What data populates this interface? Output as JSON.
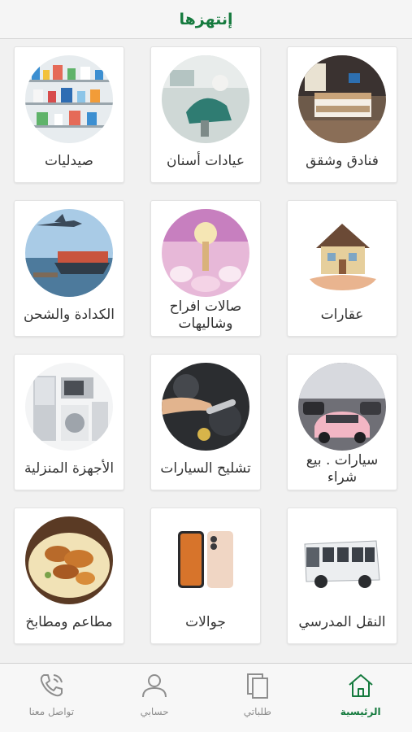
{
  "header": {
    "title": "إنتهزها"
  },
  "categories": [
    {
      "label": "فنادق وشقق",
      "icon": "hotel-room-photo"
    },
    {
      "label": "عيادات أسنان",
      "icon": "dental-clinic-photo"
    },
    {
      "label": "صيدليات",
      "icon": "pharmacy-photo"
    },
    {
      "label": "عقارات",
      "icon": "house-in-hand-photo"
    },
    {
      "label": "صالات افراح وشاليهات",
      "icon": "wedding-hall-photo"
    },
    {
      "label": "الكدادة والشحن",
      "icon": "plane-and-ship-photo"
    },
    {
      "label": "سيارات . بيع شراء",
      "icon": "car-showroom-photo"
    },
    {
      "label": "تشليح السيارات",
      "icon": "car-engine-repair-photo"
    },
    {
      "label": "الأجهزة المنزلية",
      "icon": "home-appliances-photo"
    },
    {
      "label": "النقل المدرسي",
      "icon": "school-bus-photo"
    },
    {
      "label": "جوالات",
      "icon": "mobile-phones-photo"
    },
    {
      "label": "مطاعم ومطابخ",
      "icon": "food-platter-photo"
    }
  ],
  "tabbar": {
    "active_color": "#157a3e",
    "items": [
      {
        "label": "الرئيسية",
        "icon": "home-icon",
        "active": true
      },
      {
        "label": "طلباتي",
        "icon": "orders-icon",
        "active": false
      },
      {
        "label": "حسابي",
        "icon": "user-icon",
        "active": false
      },
      {
        "label": "تواصل معنا",
        "icon": "phone-icon",
        "active": false
      }
    ]
  }
}
